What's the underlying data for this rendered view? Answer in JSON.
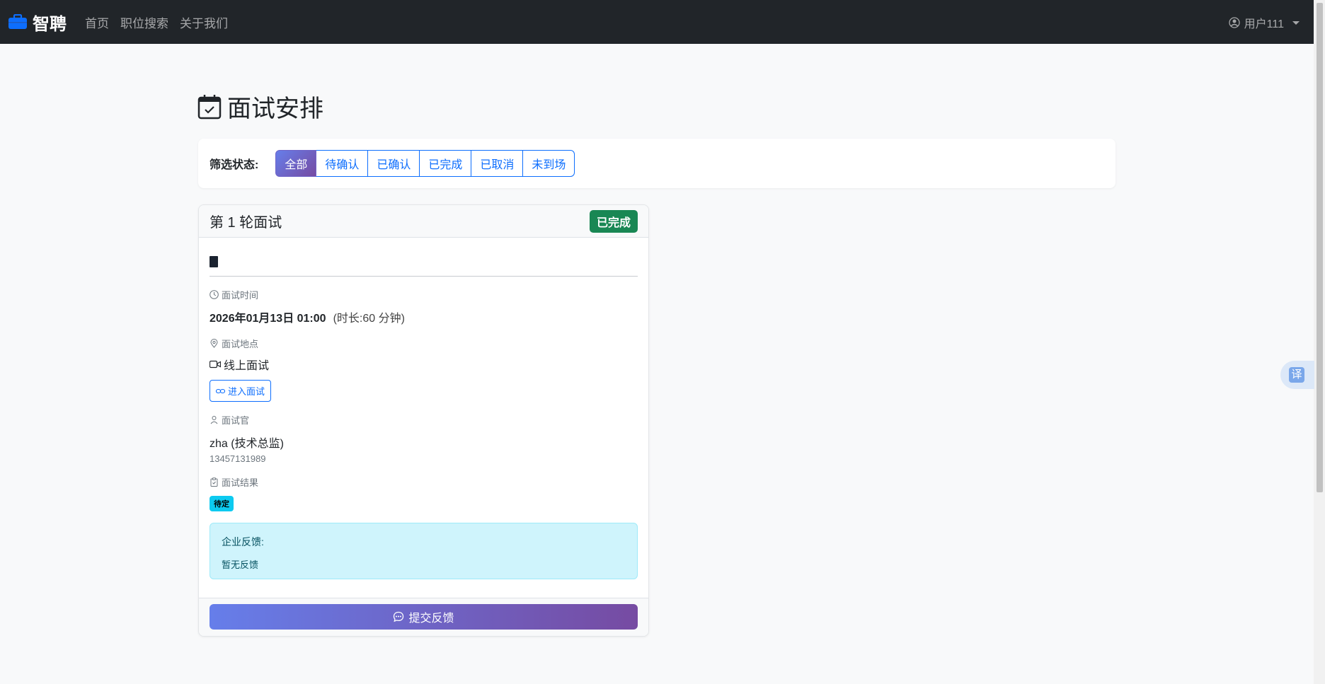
{
  "navbar": {
    "brand": "智聘",
    "links": [
      "首页",
      "职位搜索",
      "关于我们"
    ],
    "user": "用户111"
  },
  "page": {
    "title": "面试安排"
  },
  "filter": {
    "label": "筛选状态:",
    "options": [
      "全部",
      "待确认",
      "已确认",
      "已完成",
      "已取消",
      "未到场"
    ],
    "active": "全部"
  },
  "interview": {
    "round": "第 1 轮面试",
    "status": "已完成",
    "time_label": "面试时间",
    "time_value": "2026年01月13日 01:00",
    "duration": "(时长:60 分钟)",
    "location_label": "面试地点",
    "location_value": "线上面试",
    "join_button": "进入面试",
    "interviewer_label": "面试官",
    "interviewer_name": "zha (技术总监)",
    "interviewer_phone": "13457131989",
    "result_label": "面试结果",
    "result_value": "待定",
    "feedback_title": "企业反馈:",
    "feedback_text": "暂无反馈",
    "submit_button": "提交反馈"
  },
  "translate": {
    "label": "译"
  },
  "colors": {
    "navbar_bg": "#212529",
    "primary": "#0d6efd",
    "gradient_start": "#667eea",
    "gradient_end": "#764ba2",
    "success": "#198754",
    "info": "#0dcaf0"
  }
}
